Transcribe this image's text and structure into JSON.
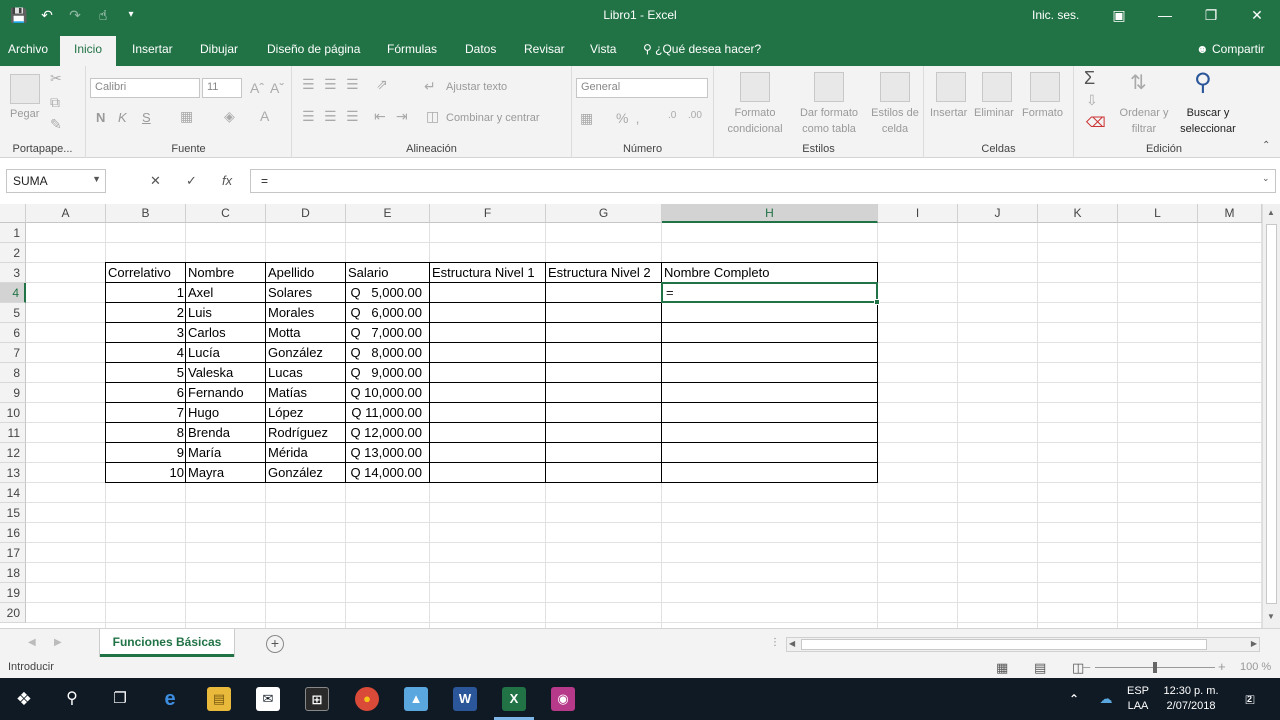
{
  "window": {
    "title": "Libro1  -  Excel",
    "signin": "Inic. ses."
  },
  "ribbon_tabs": [
    "Archivo",
    "Inicio",
    "Insertar",
    "Dibujar",
    "Diseño de página",
    "Fórmulas",
    "Datos",
    "Revisar",
    "Vista"
  ],
  "active_tab": "Inicio",
  "tell_me": "¿Qué desea hacer?",
  "share": "Compartir",
  "ribbon": {
    "clipboard": {
      "paste": "Pegar",
      "label": "Portapape..."
    },
    "font": {
      "name": "Calibri",
      "size": "11",
      "label": "Fuente",
      "bold": "N",
      "italic": "K",
      "underline": "S"
    },
    "alignment": {
      "wrap": "Ajustar texto",
      "merge": "Combinar y centrar",
      "label": "Alineación"
    },
    "number": {
      "format": "General",
      "label": "Número"
    },
    "styles": {
      "conditional": [
        "Formato",
        "condicional"
      ],
      "as_table": [
        "Dar formato",
        "como tabla"
      ],
      "cell_styles": [
        "Estilos de",
        "celda"
      ],
      "label": "Estilos"
    },
    "cells": {
      "insert": "Insertar",
      "delete": "Eliminar",
      "format": "Formato",
      "label": "Celdas"
    },
    "editing": {
      "sort": [
        "Ordenar y",
        "filtrar"
      ],
      "find": [
        "Buscar y",
        "seleccionar"
      ],
      "label": "Edición"
    }
  },
  "formula_bar": {
    "name_box": "SUMA",
    "content": "="
  },
  "sheet": {
    "columns": [
      "A",
      "B",
      "C",
      "D",
      "E",
      "F",
      "G",
      "H",
      "I",
      "J",
      "K",
      "L",
      "M"
    ],
    "selected_column": "H",
    "rows": [
      "1",
      "2",
      "3",
      "4",
      "5",
      "6",
      "7",
      "8",
      "9",
      "10",
      "11",
      "12",
      "13",
      "14",
      "15",
      "16",
      "17",
      "18",
      "19",
      "20"
    ],
    "selected_row": "4",
    "headers": [
      "Correlativo",
      "Nombre",
      "Apellido",
      "Salario",
      "Estructura Nivel 1",
      "Estructura Nivel 2",
      "Nombre Completo"
    ],
    "records": [
      [
        "1",
        "Axel",
        "Solares",
        "Q   5,000.00"
      ],
      [
        "2",
        "Luis",
        "Morales",
        "Q   6,000.00"
      ],
      [
        "3",
        "Carlos",
        "Motta",
        "Q   7,000.00"
      ],
      [
        "4",
        "Lucía",
        "González",
        "Q   8,000.00"
      ],
      [
        "5",
        "Valeska",
        "Lucas",
        "Q   9,000.00"
      ],
      [
        "6",
        "Fernando",
        "Matías",
        "Q 10,000.00"
      ],
      [
        "7",
        "Hugo",
        "López",
        "Q 11,000.00"
      ],
      [
        "8",
        "Brenda",
        "Rodríguez",
        "Q 12,000.00"
      ],
      [
        "9",
        "María",
        "Mérida",
        "Q 13,000.00"
      ],
      [
        "10",
        "Mayra",
        "González",
        "Q 14,000.00"
      ]
    ],
    "active_cell_value": "="
  },
  "sheet_tab": "Funciones Básicas",
  "status": {
    "mode": "Introducir",
    "zoom": "100 %"
  },
  "taskbar": {
    "lang": [
      "ESP",
      "LAA"
    ],
    "time": "12:30 p. m.",
    "date": "2/07/2018",
    "notifications": "2"
  },
  "colors": {
    "excel_green": "#217346",
    "taskbar": "#101a24"
  }
}
